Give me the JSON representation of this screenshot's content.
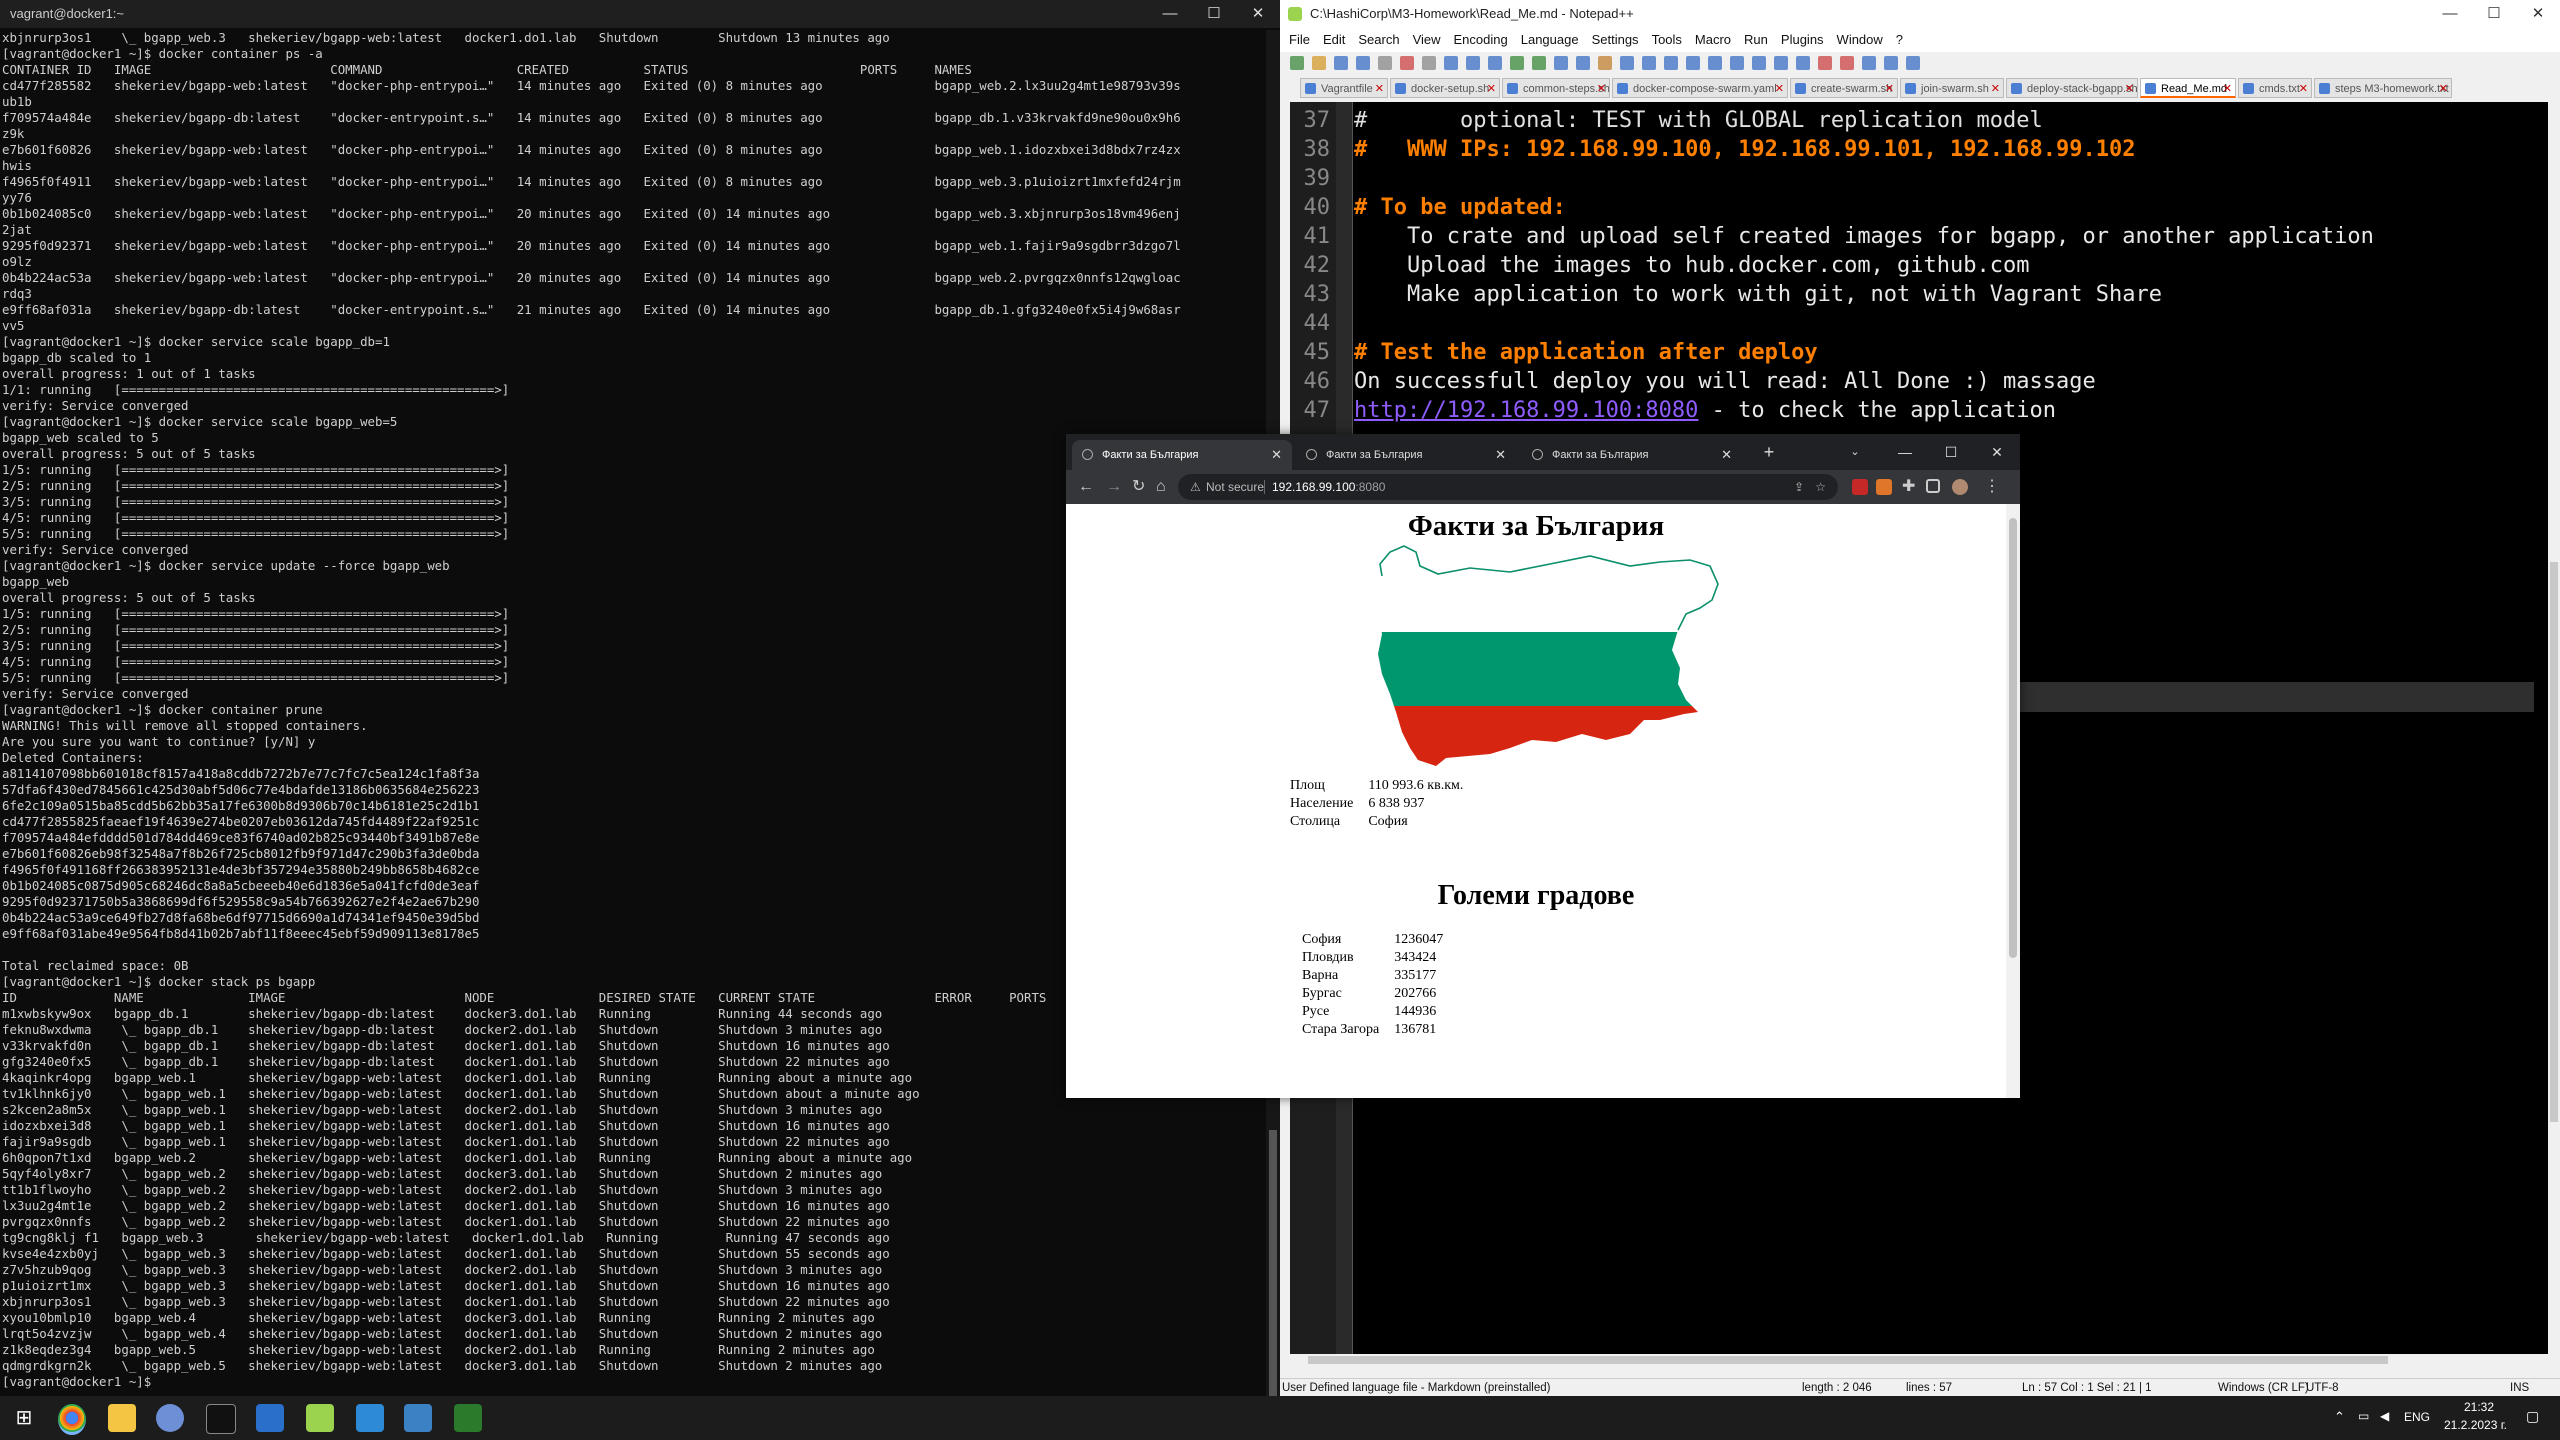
{
  "terminal": {
    "title": "vagrant@docker1:~",
    "lines": [
      "xbjnrurp3os1    \\_ bgapp_web.3   shekeriev/bgapp-web:latest   docker1.do1.lab   Shutdown        Shutdown 13 minutes ago",
      "[vagrant@docker1 ~]$ docker container ps -a",
      "CONTAINER ID   IMAGE                        COMMAND                  CREATED          STATUS                       PORTS     NAMES",
      "cd477f285582   shekeriev/bgapp-web:latest   \"docker-php-entrypoi…\"   14 minutes ago   Exited (0) 8 minutes ago               bgapp_web.2.lx3uu2g4mt1e98793v39s",
      "ub1b",
      "f709574a484e   shekeriev/bgapp-db:latest    \"docker-entrypoint.s…\"   14 minutes ago   Exited (0) 8 minutes ago               bgapp_db.1.v33krvakfd9ne90ou0x9h6",
      "z9k",
      "e7b601f60826   shekeriev/bgapp-web:latest   \"docker-php-entrypoi…\"   14 minutes ago   Exited (0) 8 minutes ago               bgapp_web.1.idozxbxei3d8bdx7rz4zx",
      "hwis",
      "f4965f0f4911   shekeriev/bgapp-web:latest   \"docker-php-entrypoi…\"   14 minutes ago   Exited (0) 8 minutes ago               bgapp_web.3.p1uioizrt1mxfefd24rjm",
      "yy76",
      "0b1b024085c0   shekeriev/bgapp-web:latest   \"docker-php-entrypoi…\"   20 minutes ago   Exited (0) 14 minutes ago              bgapp_web.3.xbjnrurp3os18vm496enj",
      "2jat",
      "9295f0d92371   shekeriev/bgapp-web:latest   \"docker-php-entrypoi…\"   20 minutes ago   Exited (0) 14 minutes ago              bgapp_web.1.fajir9a9sgdbrr3dzgo7l",
      "o9lz",
      "0b4b224ac53a   shekeriev/bgapp-web:latest   \"docker-php-entrypoi…\"   20 minutes ago   Exited (0) 14 minutes ago              bgapp_web.2.pvrgqzx0nnfs12qwgloac",
      "rdq3",
      "e9ff68af031a   shekeriev/bgapp-db:latest    \"docker-entrypoint.s…\"   21 minutes ago   Exited (0) 14 minutes ago              bgapp_db.1.gfg3240e0fx5i4j9w68asr",
      "vv5",
      "[vagrant@docker1 ~]$ docker service scale bgapp_db=1",
      "bgapp_db scaled to 1",
      "overall progress: 1 out of 1 tasks",
      "1/1: running   [==================================================>]",
      "verify: Service converged",
      "[vagrant@docker1 ~]$ docker service scale bgapp_web=5",
      "bgapp_web scaled to 5",
      "overall progress: 5 out of 5 tasks",
      "1/5: running   [==================================================>]",
      "2/5: running   [==================================================>]",
      "3/5: running   [==================================================>]",
      "4/5: running   [==================================================>]",
      "5/5: running   [==================================================>]",
      "verify: Service converged",
      "[vagrant@docker1 ~]$ docker service update --force bgapp_web",
      "bgapp_web",
      "overall progress: 5 out of 5 tasks",
      "1/5: running   [==================================================>]",
      "2/5: running   [==================================================>]",
      "3/5: running   [==================================================>]",
      "4/5: running   [==================================================>]",
      "5/5: running   [==================================================>]",
      "verify: Service converged",
      "[vagrant@docker1 ~]$ docker container prune",
      "WARNING! This will remove all stopped containers.",
      "Are you sure you want to continue? [y/N] y",
      "Deleted Containers:",
      "a8114107098bb601018cf8157a418a8cddb7272b7e77c7fc7c5ea124c1fa8f3a",
      "57dfa6f430ed7845661c425d30abf5d06c77e4bdafde13186b0635684e256223",
      "6fe2c109a0515ba85cdd5b62bb35a17fe6300b8d9306b70c14b6181e25c2d1b1",
      "cd477f2855825faeaef19f4639e274be0207eb03612da745fd4489f22af9251c",
      "f709574a484efdddd501d784dd469ce83f6740ad02b825c93440bf3491b87e8e",
      "e7b601f60826eb98f32548a7f8b26f725cb8012fb9f971d47c290b3fa3de0bda",
      "f4965f0f491168ff266383952131e4de3bf357294e35880b249bb8658b4682ce",
      "0b1b024085c0875d905c68246dc8a8a5cbeeeb40e6d1836e5a041fcfd0de3eaf",
      "9295f0d92371750b5a3868699df6f529558c9a54b766392627e2f4e2ae67b290",
      "0b4b224ac53a9ce649fb27d8fa68be6df97715d6690a1d74341ef9450e39d5bd",
      "e9ff68af031abe49e9564fb8d41b02b7abf11f8eeec45ebf59d909113e8178e5",
      "",
      "Total reclaimed space: 0B",
      "[vagrant@docker1 ~]$ docker stack ps bgapp",
      "ID             NAME              IMAGE                        NODE              DESIRED STATE   CURRENT STATE                ERROR     PORTS",
      "m1xwbskyw9ox   bgapp_db.1        shekeriev/bgapp-db:latest    docker3.do1.lab   Running         Running 44 seconds ago",
      "feknu8wxdwma    \\_ bgapp_db.1    shekeriev/bgapp-db:latest    docker2.do1.lab   Shutdown        Shutdown 3 minutes ago",
      "v33krvakfd0n    \\_ bgapp_db.1    shekeriev/bgapp-db:latest    docker1.do1.lab   Shutdown        Shutdown 16 minutes ago",
      "gfg3240e0fx5    \\_ bgapp_db.1    shekeriev/bgapp-db:latest    docker1.do1.lab   Shutdown        Shutdown 22 minutes ago",
      "4kaqinkr4opg   bgapp_web.1       shekeriev/bgapp-web:latest   docker1.do1.lab   Running         Running about a minute ago",
      "tv1klhnk6jy0    \\_ bgapp_web.1   shekeriev/bgapp-web:latest   docker1.do1.lab   Shutdown        Shutdown about a minute ago",
      "s2kcen2a8m5x    \\_ bgapp_web.1   shekeriev/bgapp-web:latest   docker2.do1.lab   Shutdown        Shutdown 3 minutes ago",
      "idozxbxei3d8    \\_ bgapp_web.1   shekeriev/bgapp-web:latest   docker1.do1.lab   Shutdown        Shutdown 16 minutes ago",
      "fajir9a9sgdb    \\_ bgapp_web.1   shekeriev/bgapp-web:latest   docker1.do1.lab   Shutdown        Shutdown 22 minutes ago",
      "6h0qpon7t1xd   bgapp_web.2       shekeriev/bgapp-web:latest   docker1.do1.lab   Running         Running about a minute ago",
      "5qyf4oly8xr7    \\_ bgapp_web.2   shekeriev/bgapp-web:latest   docker3.do1.lab   Shutdown        Shutdown 2 minutes ago",
      "tt1b1flwoyho    \\_ bgapp_web.2   shekeriev/bgapp-web:latest   docker2.do1.lab   Shutdown        Shutdown 3 minutes ago",
      "lx3uu2g4mt1e    \\_ bgapp_web.2   shekeriev/bgapp-web:latest   docker1.do1.lab   Shutdown        Shutdown 16 minutes ago",
      "pvrgqzx0nnfs    \\_ bgapp_web.2   shekeriev/bgapp-web:latest   docker1.do1.lab   Shutdown        Shutdown 22 minutes ago",
      "tg9cng8klj f1   bgapp_web.3       shekeriev/bgapp-web:latest   docker1.do1.lab   Running         Running 47 seconds ago",
      "kvse4e4zxb0yj   \\_ bgapp_web.3   shekeriev/bgapp-web:latest   docker1.do1.lab   Shutdown        Shutdown 55 seconds ago",
      "z7v5hzub9qog    \\_ bgapp_web.3   shekeriev/bgapp-web:latest   docker2.do1.lab   Shutdown        Shutdown 3 minutes ago",
      "p1uioizrt1mx    \\_ bgapp_web.3   shekeriev/bgapp-web:latest   docker1.do1.lab   Shutdown        Shutdown 16 minutes ago",
      "xbjnrurp3os1    \\_ bgapp_web.3   shekeriev/bgapp-web:latest   docker1.do1.lab   Shutdown        Shutdown 22 minutes ago",
      "xyou10bmlp10   bgapp_web.4       shekeriev/bgapp-web:latest   docker3.do1.lab   Running         Running 2 minutes ago",
      "lrqt5o4zvzjw    \\_ bgapp_web.4   shekeriev/bgapp-web:latest   docker1.do1.lab   Shutdown        Shutdown 2 minutes ago",
      "z1k8eqdez3g4   bgapp_web.5       shekeriev/bgapp-web:latest   docker2.do1.lab   Running         Running 2 minutes ago",
      "qdmgrdkgrn2k    \\_ bgapp_web.5   shekeriev/bgapp-web:latest   docker3.do1.lab   Shutdown        Shutdown 2 minutes ago",
      "[vagrant@docker1 ~]$"
    ]
  },
  "npp": {
    "title": "C:\\HashiCorp\\M3-Homework\\Read_Me.md - Notepad++",
    "menu": [
      "File",
      "Edit",
      "Search",
      "View",
      "Encoding",
      "Language",
      "Settings",
      "Tools",
      "Macro",
      "Run",
      "Plugins",
      "Window",
      "?"
    ],
    "tabs": [
      "Vagrantfile",
      "docker-setup.sh",
      "common-steps.sh",
      "docker-compose-swarm.yaml",
      "create-swarm.sh",
      "join-swarm.sh",
      "deploy-stack-bgapp.sh",
      "Read_Me.md",
      "cmds.txt",
      "steps M3-homework.txt"
    ],
    "active_tab": 7,
    "line_numbers": [
      "37",
      "38",
      "39",
      "40",
      "41",
      "42",
      "43",
      "44",
      "45",
      "46",
      "47"
    ],
    "code": {
      "l37": "#       optional: TEST with GLOBAL replication model",
      "l38": "#   WWW IPs: 192.168.99.100, 192.168.99.101, 192.168.99.102",
      "l40": "# To be updated:",
      "l41": "    To crate and upload self created images for bgapp, or another application",
      "l42": "    Upload the images to hub.docker.com, github.com",
      "l43": "    Make application to work with git, not with Vagrant Share",
      "l45": "# Test the application after deploy",
      "l46": "On successfull deploy you will read: All Done :) massage",
      "l47_link": "http://192.168.99.100:8080",
      "l47_rest": " - to check the application"
    },
    "status": {
      "lang": "User Defined language file - Markdown (preinstalled)",
      "length": "length : 2 046",
      "lines": "lines : 57",
      "pos": "Ln : 57    Col : 1    Sel : 21 | 1",
      "eol": "Windows (CR LF)",
      "enc": "UTF-8",
      "ins": "INS"
    }
  },
  "browser": {
    "tabs": [
      "Факти за България",
      "Факти за България",
      "Факти за България"
    ],
    "not_secure": "Not secure",
    "url_host": "192.168.99.100",
    "url_port": ":8080",
    "page": {
      "title": "Факти за България",
      "facts": [
        {
          "k": "Площ",
          "v": "110 993.6 кв.км."
        },
        {
          "k": "Население",
          "v": "6 838 937"
        },
        {
          "k": "Столица",
          "v": "София"
        }
      ],
      "cities_title": "Големи градове",
      "cities": [
        {
          "k": "София",
          "v": "1236047"
        },
        {
          "k": "Пловдив",
          "v": "343424"
        },
        {
          "k": "Варна",
          "v": "335177"
        },
        {
          "k": "Бургас",
          "v": "202766"
        },
        {
          "k": "Русе",
          "v": "144936"
        },
        {
          "k": "Стара Загора",
          "v": "136781"
        }
      ]
    },
    "flag_colors": {
      "white": "#ffffff",
      "green": "#00966e",
      "red": "#d62612"
    }
  },
  "taskbar": {
    "lang": "ENG",
    "time": "21:32",
    "date": "21.2.2023 г."
  }
}
